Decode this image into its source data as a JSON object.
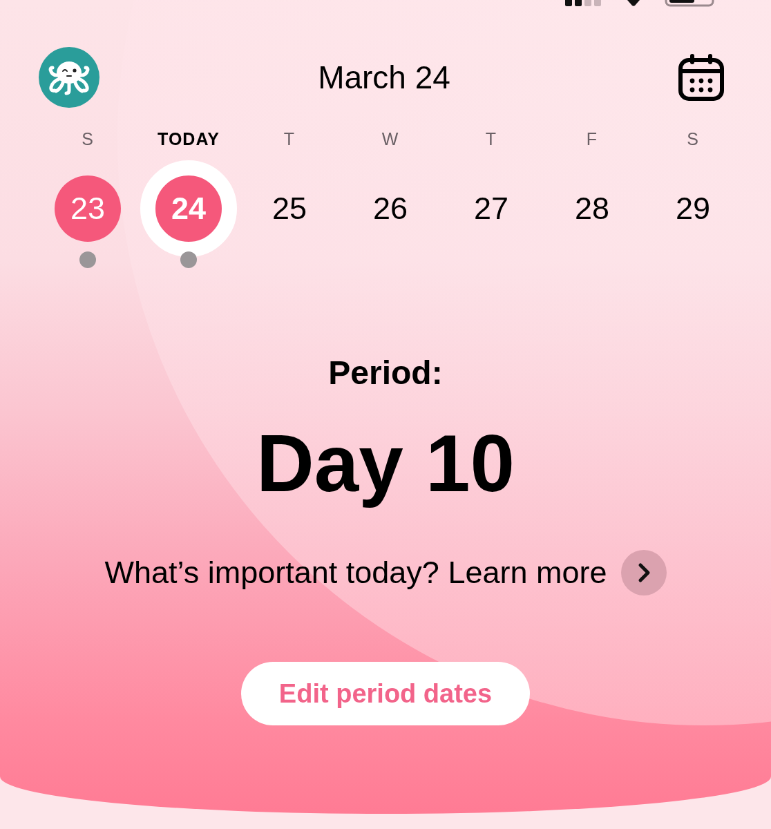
{
  "header": {
    "title": "March 24"
  },
  "days": [
    {
      "weekday": "S",
      "date": "23",
      "selected": false,
      "period": true,
      "logged": true
    },
    {
      "weekday": "TODAY",
      "date": "24",
      "selected": true,
      "period": true,
      "logged": true
    },
    {
      "weekday": "T",
      "date": "25",
      "selected": false,
      "period": false,
      "logged": false
    },
    {
      "weekday": "W",
      "date": "26",
      "selected": false,
      "period": false,
      "logged": false
    },
    {
      "weekday": "T",
      "date": "27",
      "selected": false,
      "period": false,
      "logged": false
    },
    {
      "weekday": "F",
      "date": "28",
      "selected": false,
      "period": false,
      "logged": false
    },
    {
      "weekday": "S",
      "date": "29",
      "selected": false,
      "period": false,
      "logged": false
    }
  ],
  "cycle": {
    "phase_label": "Period:",
    "day_label": "Day 10"
  },
  "learn_more": {
    "text": "What’s important today? Learn more"
  },
  "edit_button": {
    "label": "Edit period dates"
  }
}
